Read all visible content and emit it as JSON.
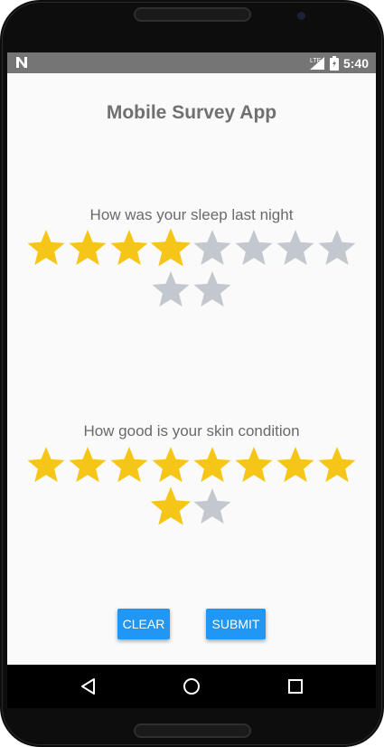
{
  "status_bar": {
    "time": "5:40",
    "network_label": "LTE",
    "icons": [
      "n-notification-icon",
      "signal-icon",
      "battery-charging-icon"
    ]
  },
  "app": {
    "title": "Mobile Survey App"
  },
  "questions": [
    {
      "text": "How was your sleep last night",
      "rating": 4,
      "max": 10
    },
    {
      "text": "How good is your skin condition",
      "rating": 9,
      "max": 10
    }
  ],
  "buttons": {
    "clear": "CLEAR",
    "submit": "SUBMIT"
  },
  "colors": {
    "star_filled": "#f5c518",
    "star_empty": "#c3c8cf",
    "button": "#2196f3",
    "title": "#707070",
    "status_bar": "#757575"
  },
  "nav_bar": {
    "icons": [
      "back-icon",
      "home-icon",
      "recents-icon"
    ]
  }
}
